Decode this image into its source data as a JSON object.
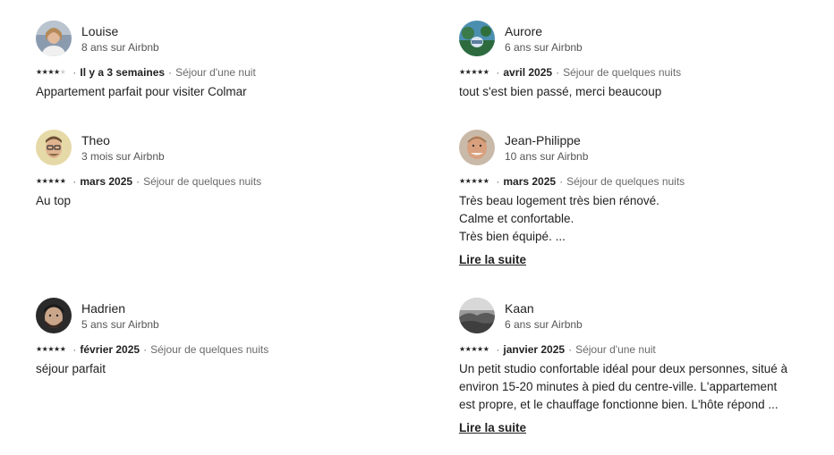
{
  "reviews": [
    {
      "name": "Louise",
      "tenure": "8 ans sur Airbnb",
      "rating": 4,
      "date": "Il y a 3 semaines",
      "stay": "Séjour d'une nuit",
      "text": "Appartement parfait pour visiter Colmar",
      "read_more": ""
    },
    {
      "name": "Aurore",
      "tenure": "6 ans sur Airbnb",
      "rating": 5,
      "date": "avril 2025",
      "stay": "Séjour de quelques nuits",
      "text": "tout s'est bien passé,  merci beaucoup",
      "read_more": ""
    },
    {
      "name": "Theo",
      "tenure": "3 mois sur Airbnb",
      "rating": 5,
      "date": "mars 2025",
      "stay": "Séjour de quelques nuits",
      "text": "Au top",
      "read_more": ""
    },
    {
      "name": "Jean-Philippe",
      "tenure": "10 ans sur Airbnb",
      "rating": 5,
      "date": "mars 2025",
      "stay": "Séjour de quelques nuits",
      "text_lines": [
        "Très beau logement très bien rénové.",
        "Calme et confortable.",
        "Très bien équipé. ..."
      ],
      "read_more": "Lire la suite"
    },
    {
      "name": "Hadrien",
      "tenure": "5 ans sur Airbnb",
      "rating": 5,
      "date": "février 2025",
      "stay": "Séjour de quelques nuits",
      "text": "séjour parfait",
      "read_more": ""
    },
    {
      "name": "Kaan",
      "tenure": "6 ans sur Airbnb",
      "rating": 5,
      "date": "janvier 2025",
      "stay": "Séjour d'une nuit",
      "text_lines": [
        "Un petit studio confortable idéal pour deux personnes, situé à",
        "environ 15-20 minutes à pied du centre-ville. L'appartement",
        "est propre, et le chauffage fonctionne bien. L'hôte répond ..."
      ],
      "read_more": "Lire la suite"
    }
  ],
  "star_glyph": "★",
  "separator": "·",
  "colors": {
    "text": "#222222",
    "muted": "#6a6a6a",
    "star_off": "#cfcfcf"
  }
}
